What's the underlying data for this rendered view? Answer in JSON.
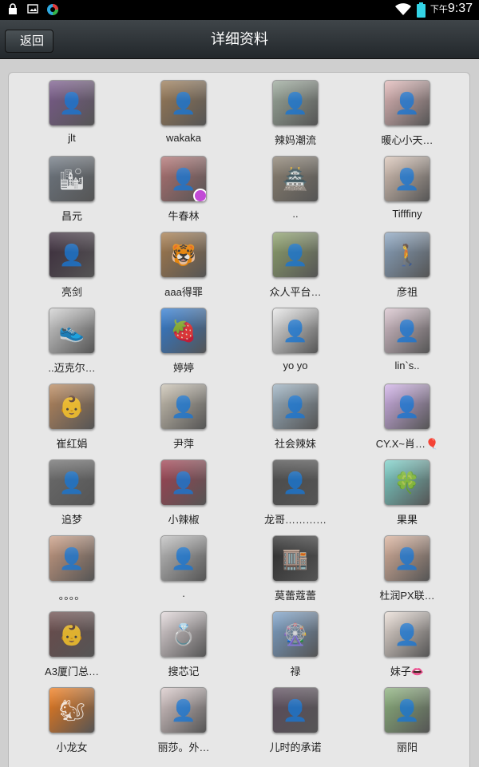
{
  "status_bar": {
    "ampm": "下午",
    "time": "9:37",
    "icons": [
      "lock-icon",
      "image-icon",
      "color-wheel-icon",
      "wifi-icon",
      "battery-icon"
    ]
  },
  "header": {
    "back_label": "返回",
    "title": "详细资料"
  },
  "contacts": [
    {
      "name": "jlt",
      "color": "#7a5a8c",
      "glyph": "👤"
    },
    {
      "name": "wakaka",
      "color": "#9a7a55",
      "glyph": "👤"
    },
    {
      "name": "辣妈潮流",
      "color": "#9aa89a",
      "glyph": "👤"
    },
    {
      "name": "暖心小天…",
      "color": "#e2b8b8",
      "glyph": "👤"
    },
    {
      "name": "昌元",
      "color": "#6d7680",
      "glyph": "🏙"
    },
    {
      "name": "牛春林",
      "color": "#b07070",
      "glyph": "👤",
      "badge": true
    },
    {
      "name": "..",
      "color": "#8a7f6f",
      "glyph": "🏯"
    },
    {
      "name": "Tifffiny",
      "color": "#d9c4b6",
      "glyph": "👤"
    },
    {
      "name": "亮剑",
      "color": "#3a2a3a",
      "glyph": "👤"
    },
    {
      "name": "aaa得罪",
      "color": "#a57a4a",
      "glyph": "🐯"
    },
    {
      "name": "众人平台…",
      "color": "#8ca06a",
      "glyph": "👤"
    },
    {
      "name": "彦祖",
      "color": "#8aa4c0",
      "glyph": "🚶"
    },
    {
      "name": "..迈克尔…",
      "color": "#cfcfcf",
      "glyph": "👟"
    },
    {
      "name": "婷婷",
      "color": "#2e7bd3",
      "glyph": "🍓"
    },
    {
      "name": "yo yo",
      "color": "#e6e6e6",
      "glyph": "👤"
    },
    {
      "name": "lin`s..",
      "color": "#d8c2cc",
      "glyph": "👤"
    },
    {
      "name": "崔红娟",
      "color": "#b8865a",
      "glyph": "👶"
    },
    {
      "name": "尹萍",
      "color": "#c8c0b0",
      "glyph": "👤"
    },
    {
      "name": "社会辣妹",
      "color": "#9ab0c0",
      "glyph": "👤"
    },
    {
      "name": "CY.X~肖…🎈",
      "color": "#d0b0e8",
      "glyph": "👤"
    },
    {
      "name": "追梦",
      "color": "#6b6b6b",
      "glyph": "👤"
    },
    {
      "name": "小辣椒",
      "color": "#a04050",
      "glyph": "👤"
    },
    {
      "name": "龙哥…………",
      "color": "#4a4a4a",
      "glyph": "👤"
    },
    {
      "name": "果果",
      "color": "#79d0c8",
      "glyph": "🍀"
    },
    {
      "name": "。。。。",
      "color": "#c89a80",
      "glyph": "👤"
    },
    {
      "name": ".",
      "color": "#bdbdbd",
      "glyph": "👤"
    },
    {
      "name": "莫蕾蔻蕾",
      "color": "#2a2a2a",
      "glyph": "🏬"
    },
    {
      "name": "杜润PX联…",
      "color": "#d9b09a",
      "glyph": "👤"
    },
    {
      "name": "A3厦门总…",
      "color": "#6a4a4a",
      "glyph": "👶"
    },
    {
      "name": "搜芯记",
      "color": "#e0d6d8",
      "glyph": "💍"
    },
    {
      "name": "禄",
      "color": "#7aa0c8",
      "glyph": "🎡"
    },
    {
      "name": "妹子👄",
      "color": "#e8dcd4",
      "glyph": "👤"
    },
    {
      "name": "小龙女",
      "color": "#f07a18",
      "glyph": "🐿"
    },
    {
      "name": "丽莎。外…",
      "color": "#d8c8c8",
      "glyph": "👤"
    },
    {
      "name": "儿时的承诺",
      "color": "#5a4a5a",
      "glyph": "👤"
    },
    {
      "name": "丽阳",
      "color": "#8ab07a",
      "glyph": "👤"
    }
  ]
}
